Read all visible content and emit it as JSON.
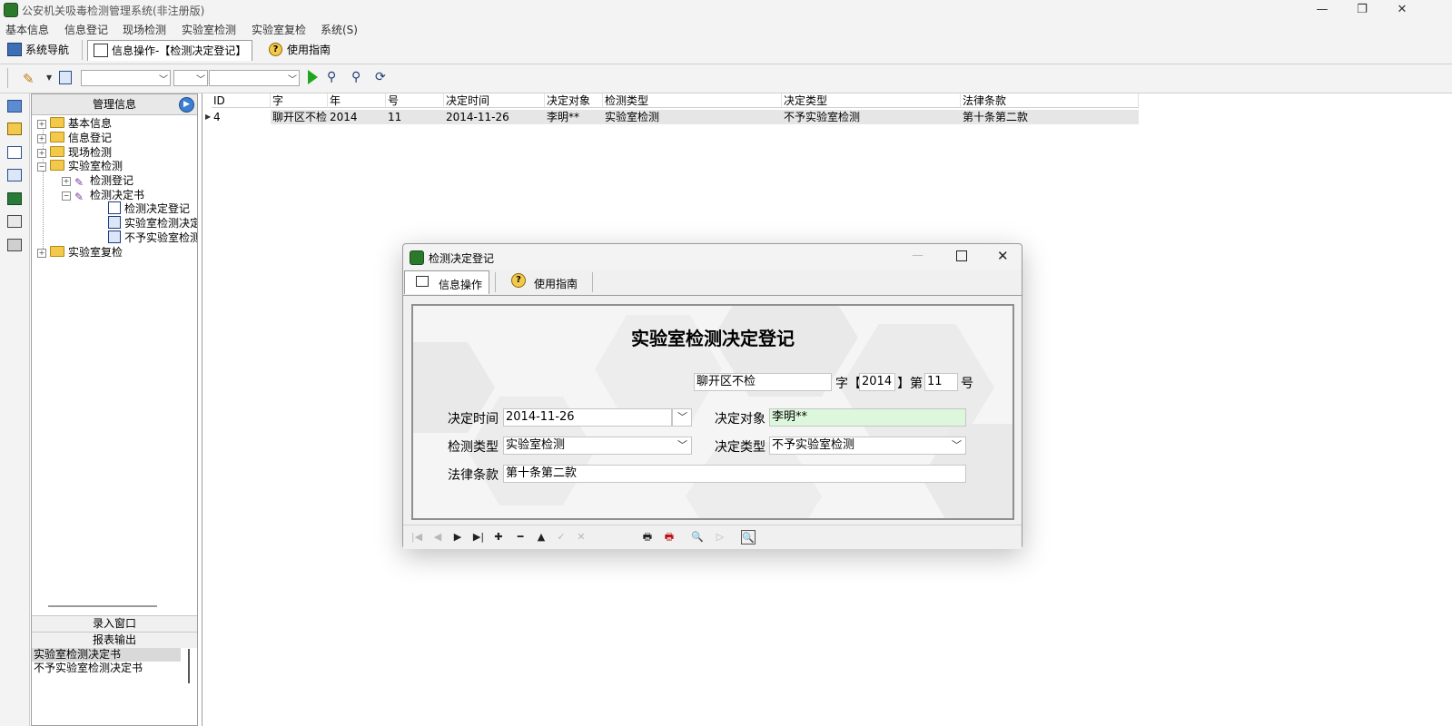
{
  "window": {
    "title": "公安机关吸毒检测管理系统(非注册版)",
    "controls": {
      "minimize": "—",
      "restore": "❐",
      "close": "✕"
    }
  },
  "menu": [
    "基本信息",
    "信息登记",
    "现场检测",
    "实验室检测",
    "实验室复检",
    "系统(S)"
  ],
  "tabs": [
    {
      "label": "系统导航",
      "icon": "monitor-icon"
    },
    {
      "label": "信息操作-【检测决定登记】",
      "icon": "table-icon",
      "active": true
    },
    {
      "label": "使用指南",
      "icon": "help-icon"
    }
  ],
  "toolbar": {
    "combos": [
      "",
      "",
      ""
    ],
    "icons": [
      "edit-pencil-icon",
      "search-document-icon",
      "run-play-icon",
      "find-icon",
      "find-next-icon",
      "refresh-icon"
    ]
  },
  "tree": {
    "header": "管理信息",
    "nodes": [
      {
        "label": "基本信息",
        "type": "folder",
        "expander": "+"
      },
      {
        "label": "信息登记",
        "type": "folder",
        "expander": "+"
      },
      {
        "label": "现场检测",
        "type": "folder",
        "expander": "+"
      },
      {
        "label": "实验室检测",
        "type": "folder",
        "expander": "−"
      },
      {
        "label": "检测登记",
        "type": "pencil",
        "expander": "+"
      },
      {
        "label": "检测决定书",
        "type": "pencil",
        "expander": "−"
      },
      {
        "label": "检测决定登记",
        "type": "table"
      },
      {
        "label": "实验室检测决定",
        "type": "doc"
      },
      {
        "label": "不予实验室检测",
        "type": "doc"
      },
      {
        "label": "实验室复检",
        "type": "folder",
        "expander": "+"
      }
    ],
    "buttons": {
      "entry": "录入窗口",
      "report": "报表输出"
    },
    "reports": [
      "实验室检测决定书",
      "不予实验室检测决定书"
    ]
  },
  "grid": {
    "columns": [
      "ID",
      "字",
      "年",
      "号",
      "决定时间",
      "决定对象",
      "检测类型",
      "决定类型",
      "法律条款"
    ],
    "rows": [
      [
        "4",
        "聊开区不检",
        "2014",
        "11",
        "2014-11-26",
        "李明**",
        "实验室检测",
        "不予实验室检测",
        "第十条第二款"
      ]
    ]
  },
  "dialog": {
    "title": "检测决定登记",
    "tabs": [
      "信息操作",
      "使用指南"
    ],
    "form": {
      "heading": "实验室检测决定登记",
      "zi_value": "聊开区不检",
      "zi_label": "字【",
      "year_value": "2014",
      "di_label": "】第",
      "num_value": "11",
      "hao_label": "号",
      "decision_time_label": "决定时间",
      "decision_time_value": "2014-11-26",
      "decision_target_label": "决定对象",
      "decision_target_value": "李明**",
      "test_type_label": "检测类型",
      "test_type_value": "实验室检测",
      "decision_type_label": "决定类型",
      "decision_type_value": "不予实验室检测",
      "law_label": "法律条款",
      "law_value": "第十条第二款"
    },
    "navbar": [
      "first-record-icon",
      "prev-record-icon",
      "next-record-icon",
      "last-record-icon",
      "add-record-icon",
      "delete-record-icon",
      "edit-up-icon",
      "post-check-icon",
      "cancel-icon",
      "print-icon",
      "print-preview-icon",
      "search-icon",
      "run-icon",
      "zoom-icon"
    ],
    "nav_glyphs": [
      "|◀",
      "◀",
      "▶",
      "▶|",
      "✚",
      "━",
      "▲",
      "✓",
      "✕",
      "🖶",
      "🖶",
      "🔍",
      "▷",
      "🔍"
    ]
  },
  "colors": {
    "target_field_bg": "#dcf7dc",
    "grid_row_bg": "#e6e6e6"
  }
}
